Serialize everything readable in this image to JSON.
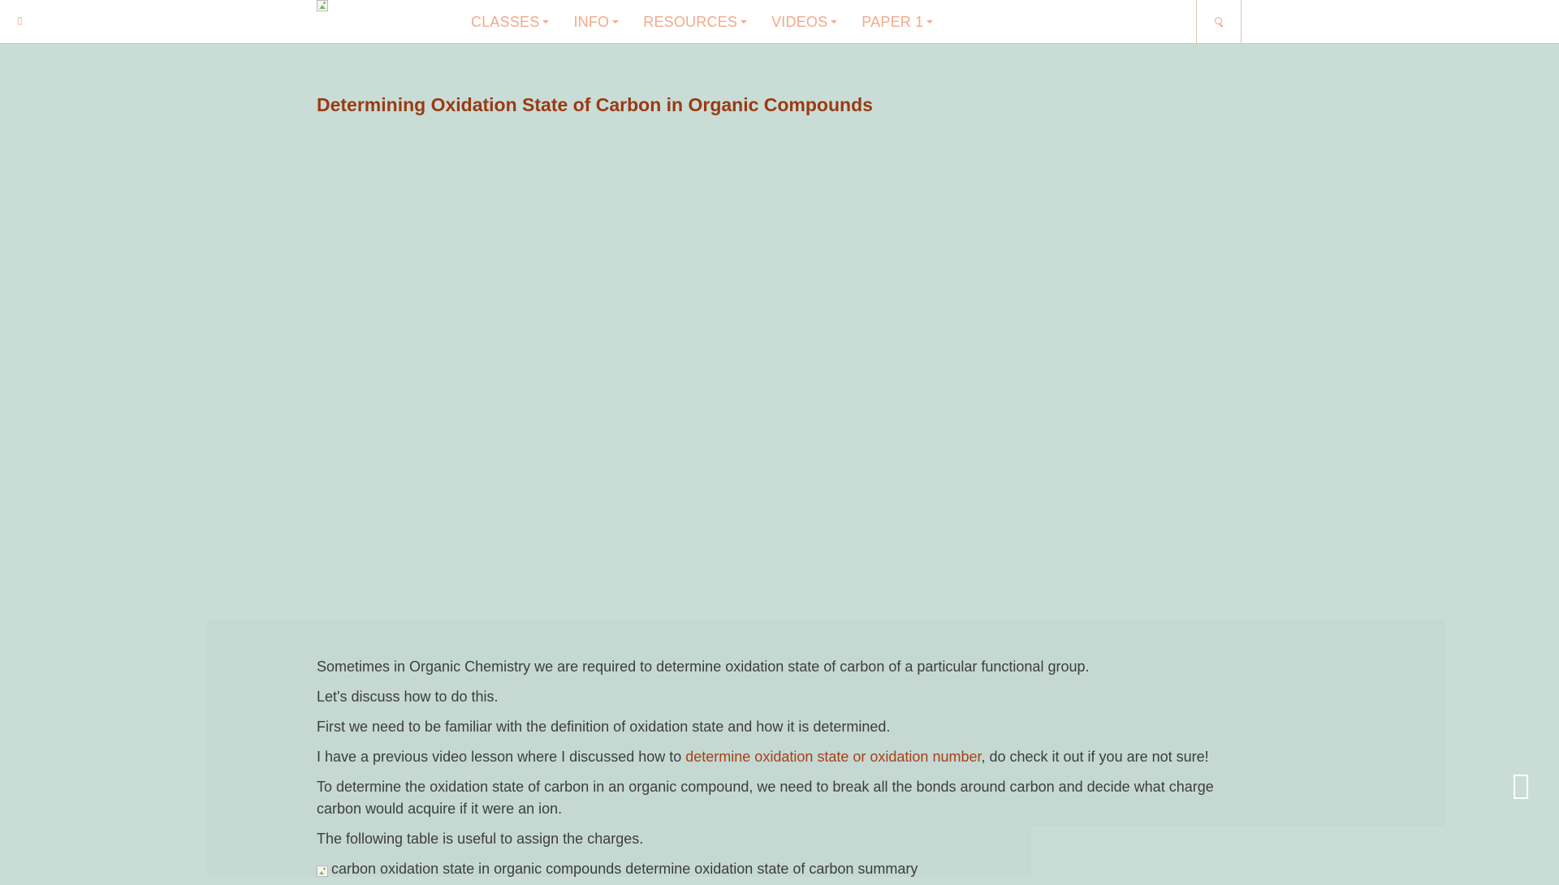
{
  "nav": {
    "menu": [
      {
        "label": "CLASSES"
      },
      {
        "label": "INFO"
      },
      {
        "label": "RESOURCES"
      },
      {
        "label": "VIDEOS"
      },
      {
        "label": "PAPER 1"
      }
    ],
    "icons": {
      "toggle": "menu-glyph",
      "search": "search-icon",
      "logo": "broken-image-icon"
    }
  },
  "article": {
    "title": "Determining Oxidation State of Carbon in Organic Compounds",
    "p1": "Sometimes in Organic Chemistry we are required to determine oxidation state of carbon of a particular functional group.",
    "p2": "Let's discuss how to do this.",
    "p3": "First we need to be familiar with the definition of oxidation state and how it is determined.",
    "p4_before": "I have a previous video lesson where I discussed how to ",
    "p4_link": "determine oxidation state or oxidation number",
    "p4_after": ", do check it out if you are not sure!",
    "p5": "To determine the oxidation state of carbon in an organic compound, we need to break all the bonds around carbon and decide what charge carbon would acquire if it were an ion.",
    "p6": "The following table is useful to assign the charges.",
    "img_alt": "carbon oxidation state in organic compounds determine oxidation state of carbon summary"
  },
  "colors": {
    "background": "#c9ddd6",
    "title": "#9a3a14",
    "link": "#a6401a",
    "menu": "#f3a98a"
  }
}
